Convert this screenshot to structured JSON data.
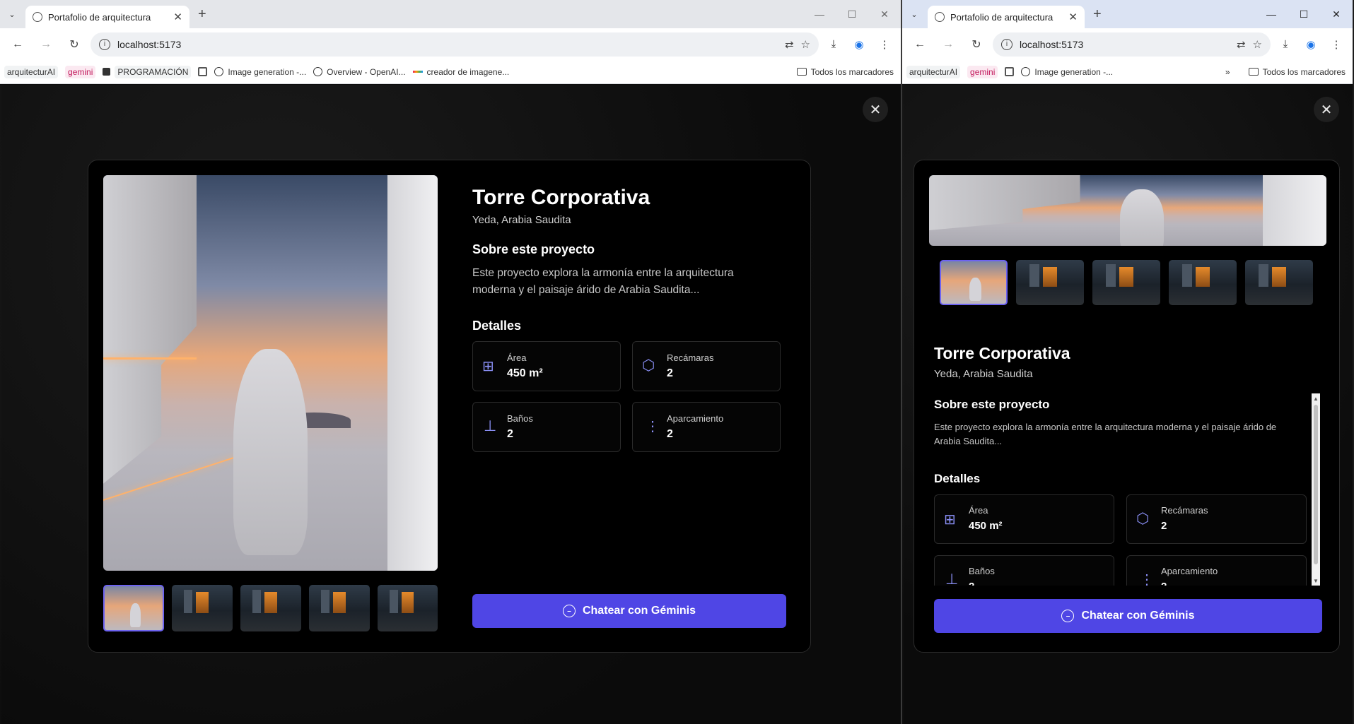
{
  "browser": {
    "tab_title": "Portafolio de arquitectura",
    "url": "localhost:5173",
    "bookmarks_left": [
      "arquitecturAI",
      "gemini",
      "PROGRAMACIÓN",
      "Image generation -...",
      "Overview - OpenAI...",
      "creador de imagene..."
    ],
    "bookmarks_right": [
      "arquitecturAI",
      "gemini",
      "Image generation -..."
    ],
    "all_bookmarks": "Todos los marcadores",
    "overflow": "»"
  },
  "project": {
    "title": "Torre Corporativa",
    "location": "Yeda, Arabia Saudita",
    "about_heading": "Sobre este proyecto",
    "description": "Este proyecto explora la armonía entre la arquitectura moderna y el paisaje árido de Arabia Saudita...",
    "details_heading": "Detalles",
    "details": [
      {
        "icon": "area-icon",
        "glyph": "⊞",
        "label": "Área",
        "value": "450 m²"
      },
      {
        "icon": "cube-icon",
        "glyph": "⬡",
        "label": "Recámaras",
        "value": "2"
      },
      {
        "icon": "bath-icon",
        "glyph": "⊥",
        "label": "Baños",
        "value": "2"
      },
      {
        "icon": "dots-vertical-icon",
        "glyph": "⋮",
        "label": "Aparcamiento",
        "value": "2"
      }
    ],
    "chat_button": "Chatear con Géminis",
    "thumbnail_count": 5
  },
  "colors": {
    "accent": "#4f46e5",
    "icon": "#8a8ff5",
    "background": "#000000"
  }
}
